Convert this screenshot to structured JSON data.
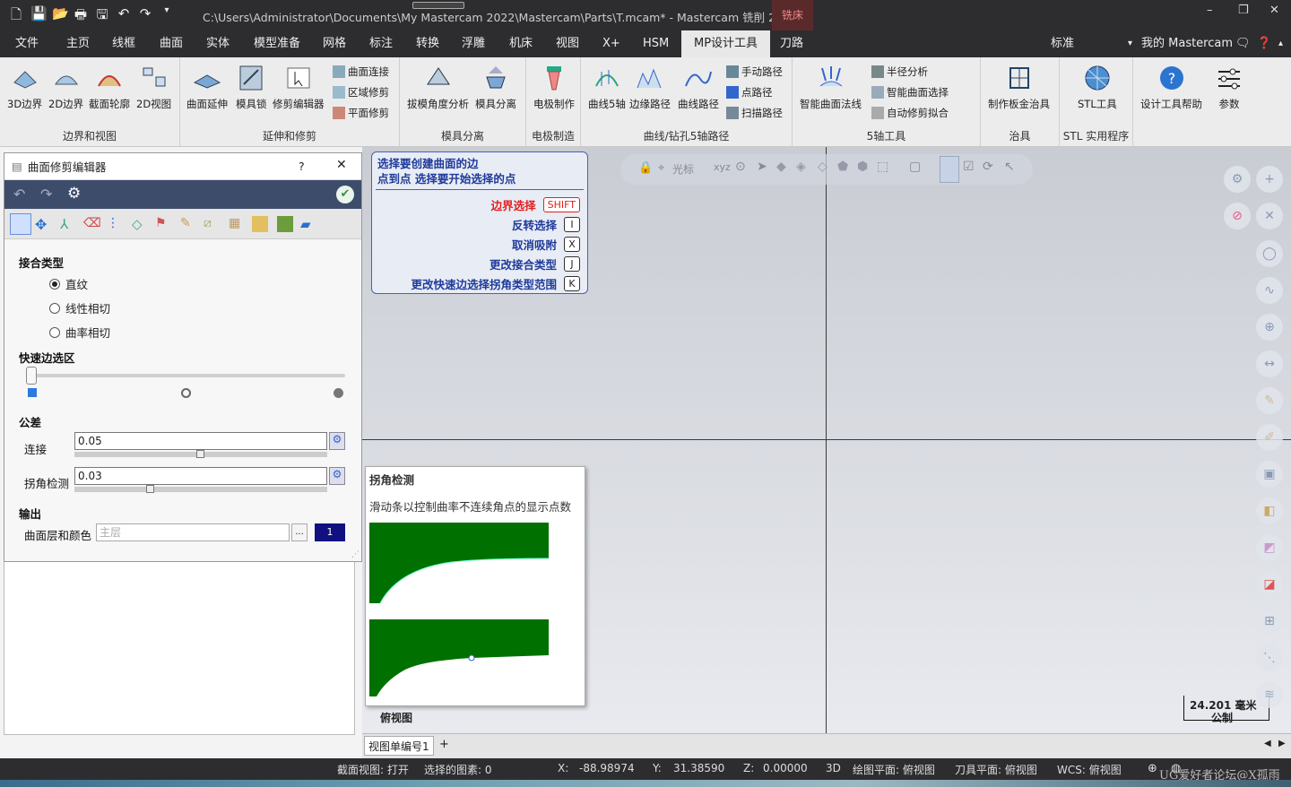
{
  "titlebar": {
    "path": "C:\\Users\\Administrator\\Documents\\My Mastercam 2022\\Mastercam\\Parts\\T.mcam* - Mastercam 铣削 2022",
    "context_tag": "铣床"
  },
  "menu": {
    "items": [
      "文件",
      "主页",
      "线框",
      "曲面",
      "实体",
      "模型准备",
      "网格",
      "标注",
      "转换",
      "浮雕",
      "机床",
      "视图",
      "X+",
      "HSM",
      "MP设计工具",
      "刀路"
    ],
    "active": "MP设计工具",
    "right_label": "标准",
    "my_mastercam": "我的 Mastercam"
  },
  "ribbon": {
    "groups": [
      {
        "label": "边界和视图",
        "buttons": [
          "3D边界",
          "2D边界",
          "截面轮廓",
          "2D视图"
        ]
      },
      {
        "label": "延伸和修剪",
        "buttons": [
          "曲面延伸",
          "模具锁",
          "修剪编辑器"
        ],
        "small": [
          "曲面连接",
          "区域修剪",
          "平面修剪"
        ]
      },
      {
        "label": "模具分离",
        "buttons": [
          "拔模角度分析",
          "模具分离"
        ]
      },
      {
        "label": "电极制造",
        "buttons": [
          "电极制作"
        ]
      },
      {
        "label": "曲线/钻孔5轴路径",
        "buttons": [
          "曲线5轴",
          "边缘路径",
          "曲线路径"
        ],
        "small": [
          "手动路径",
          "点路径",
          "扫描路径"
        ]
      },
      {
        "label": "5轴工具",
        "buttons": [
          "智能曲面法线"
        ],
        "small": [
          "半径分析",
          "智能曲面选择",
          "自动修剪拟合"
        ]
      },
      {
        "label": "治具",
        "buttons": [
          "制作板金治具"
        ]
      },
      {
        "label": "STL 实用程序",
        "buttons": [
          "STL工具"
        ]
      },
      {
        "label": "",
        "buttons": [
          "设计工具帮助",
          "参数"
        ]
      }
    ]
  },
  "dialog": {
    "title": "曲面修剪编辑器",
    "help": "?",
    "blend_type_label": "接合类型",
    "blend_options": [
      "直纹",
      "线性相切",
      "曲率相切"
    ],
    "blend_selected": 0,
    "quick_edge_label": "快速边选区",
    "tolerance_label": "公差",
    "connect_label": "连接",
    "connect_value": "0.05",
    "corner_label": "拐角检测",
    "corner_value": "0.03",
    "output_label": "输出",
    "layer_label": "曲面层和颜色",
    "layer_placeholder": "主层",
    "layer_button": "...",
    "color_value": "1"
  },
  "hint": {
    "line1": "选择要创建曲面的边",
    "line2": "点到点 选择要开始选择的点",
    "rows": [
      {
        "label": "边界选择",
        "key": "SHIFT",
        "highlight": true
      },
      {
        "label": "反转选择",
        "key": "I"
      },
      {
        "label": "取消吸附",
        "key": "X"
      },
      {
        "label": "更改接合类型",
        "key": "J"
      },
      {
        "label": "更改快速边选择拐角类型范围",
        "key": "K"
      }
    ]
  },
  "tooltip": {
    "title": "拐角检测",
    "text": "滑动条以控制曲率不连续角点的显示点数"
  },
  "viewport": {
    "toolbar_cursor": "光标",
    "view_name": "俯视图",
    "scale_value": "24.201 毫米",
    "scale_unit": "公制"
  },
  "tabs": {
    "viewsheet": "视图单编号1",
    "add": "+"
  },
  "status": {
    "section_view": "截面视图: 打开",
    "selected": "选择的图素: 0",
    "x_label": "X:",
    "x": "-88.98974",
    "y_label": "Y:",
    "y": "31.38590",
    "z_label": "Z:",
    "z": "0.00000",
    "mode": "3D",
    "cplane": "绘图平面: 俯视图",
    "tplane": "刀具平面: 俯视图",
    "wcs": "WCS: 俯视图",
    "watermark": "UG爱好者论坛@X孤雨"
  }
}
